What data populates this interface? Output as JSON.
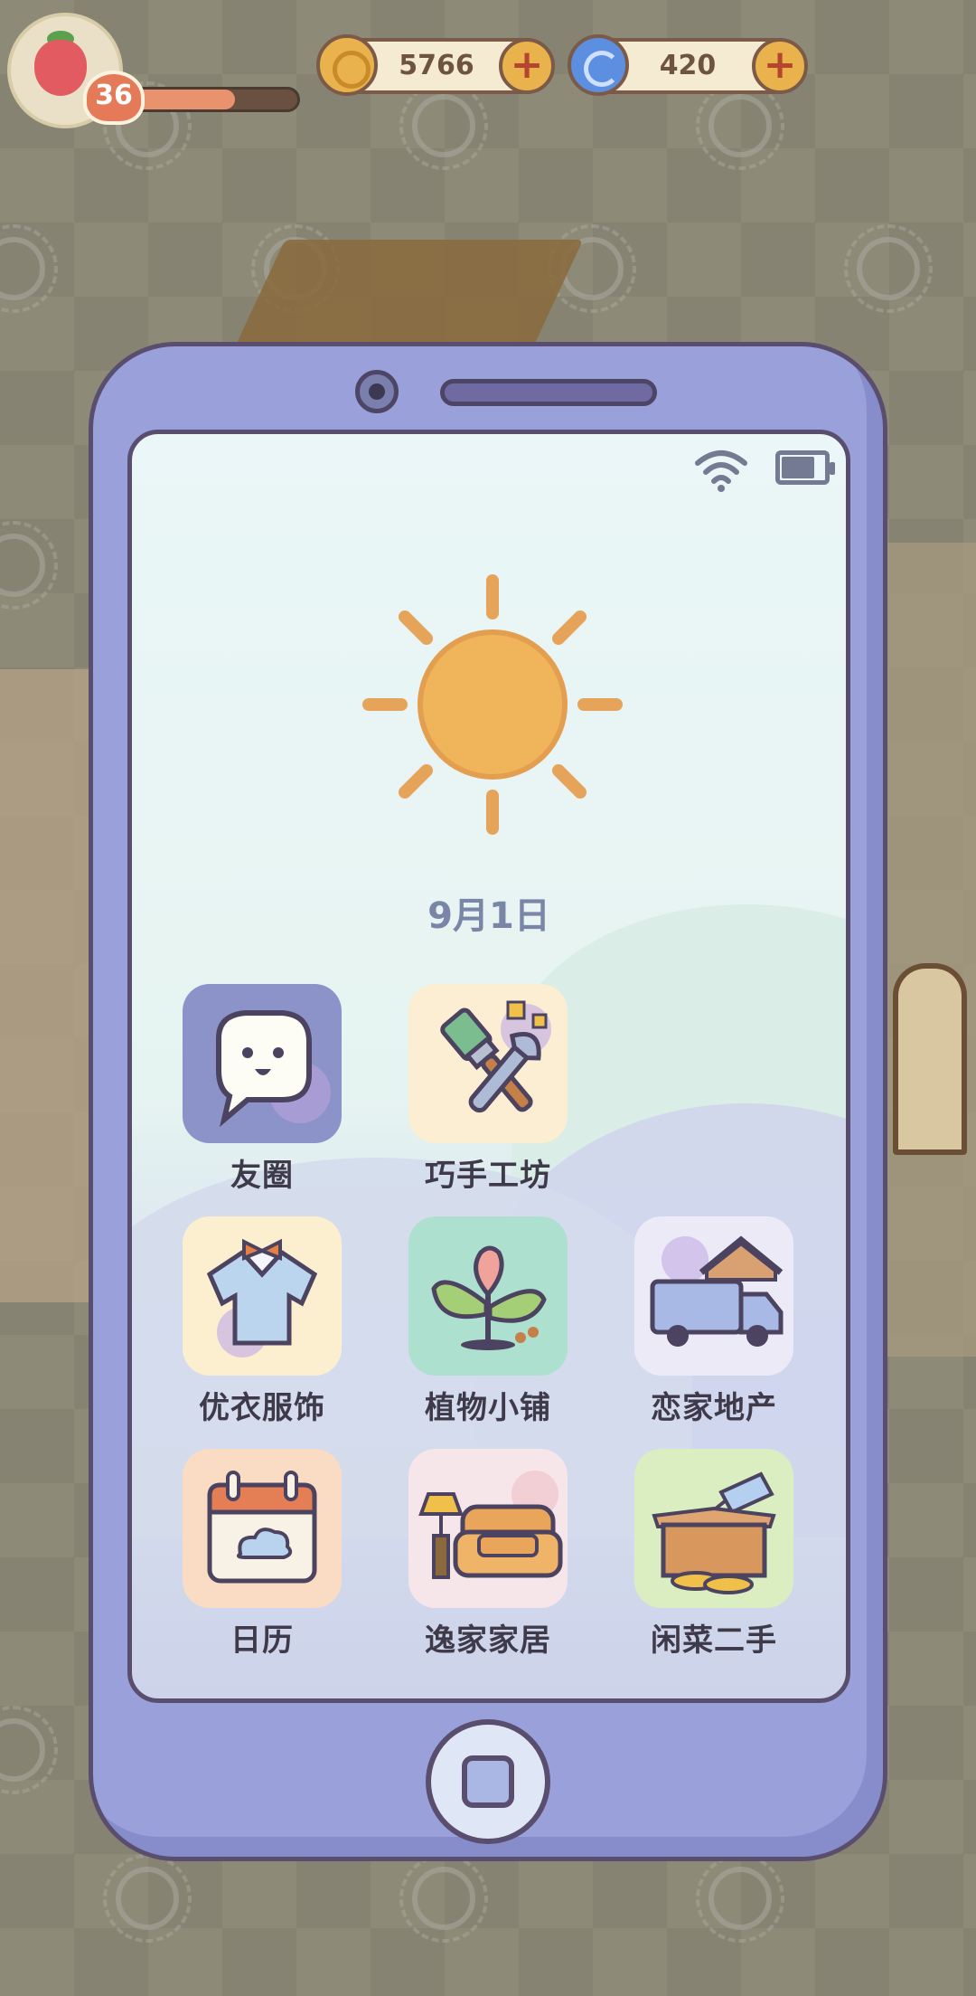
{
  "hud": {
    "level": "36",
    "xp_progress": 0.63,
    "coins": {
      "value": "5766",
      "icon": "coin-icon",
      "color": "#e9b24c"
    },
    "gems": {
      "value": "420",
      "icon": "swirl-icon",
      "color": "#5c8fe0"
    },
    "add_icon": "plus-icon"
  },
  "phone": {
    "status": {
      "wifi_icon": "wifi-icon",
      "battery_icon": "battery-icon"
    },
    "weather_icon": "sun-icon",
    "date": "9月1日",
    "apps": [
      {
        "label": "友圈",
        "icon": "speech-bubble-icon",
        "bg": "#8c93c9"
      },
      {
        "label": "巧手工坊",
        "icon": "paintbrush-wrench-icon",
        "bg": "#fbeed2"
      },
      {
        "label": "优衣服饰",
        "icon": "shirt-icon",
        "bg": "#fcefd0"
      },
      {
        "label": "植物小铺",
        "icon": "sprout-icon",
        "bg": "#aee0d0"
      },
      {
        "label": "恋家地产",
        "icon": "moving-truck-icon",
        "bg": "#eceaf7"
      },
      {
        "label": "日历",
        "icon": "calendar-icon",
        "bg": "#f9dcc3"
      },
      {
        "label": "逸家家居",
        "icon": "sofa-lamp-icon",
        "bg": "#f6e6e9"
      },
      {
        "label": "闲菜二手",
        "icon": "box-tag-icon",
        "bg": "#dbeec2"
      }
    ],
    "home_button_icon": "home-square-icon"
  },
  "colors": {
    "phone_body": "#9aa0da",
    "outline": "#5a4e6e",
    "sun": "#f0b55a"
  }
}
